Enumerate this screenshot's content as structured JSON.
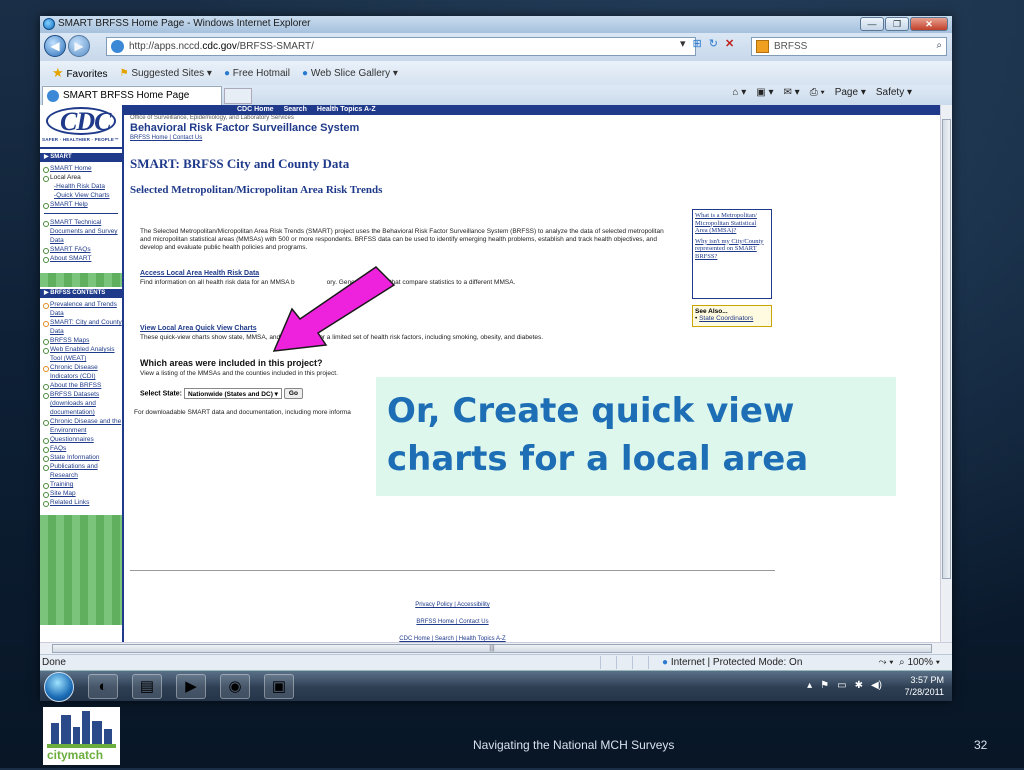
{
  "browser": {
    "title": "SMART BRFSS Home Page - Windows Internet Explorer",
    "url_prefix": "http://apps.nccd.",
    "url_domain": "cdc.gov",
    "url_path": "/BRFSS-SMART/",
    "search_placeholder": "BRFSS",
    "favorites_label": "Favorites",
    "fav_items": [
      "Suggested Sites ▾",
      "Free Hotmail",
      "Web Slice Gallery ▾"
    ],
    "tab_title": "SMART BRFSS Home Page",
    "command_items": [
      "Page ▾",
      "Safety ▾"
    ]
  },
  "status": {
    "left": "Done",
    "zone": "Internet | Protected Mode: On",
    "zoom": "100%"
  },
  "taskbar": {
    "time": "3:57 PM",
    "date": "7/28/2011"
  },
  "cdc": {
    "logo": "CDC",
    "logo_tag": "SAFER · HEALTHIER · PEOPLE™",
    "top_links": [
      "CDC Home",
      "Search",
      "Health Topics A-Z"
    ],
    "office": "Office of Surveillance, Epidemiology, and Laboratory Services",
    "system_name": "Behavioral Risk Factor Surveillance System",
    "header_links": "BRFSS Home | Contact Us",
    "sidebar_smart_head": "SMART",
    "sidebar_smart": [
      {
        "label": "SMART Home",
        "link": true
      },
      {
        "label": "Local Area",
        "link": false
      },
      {
        "label": "-Health Risk Data",
        "link": true,
        "sub": true
      },
      {
        "label": "-Quick View Charts",
        "link": true,
        "sub": true
      },
      {
        "label": "SMART Help",
        "link": true
      }
    ],
    "sidebar_smart2": [
      "SMART Technical Documents and Survey Data",
      "SMART FAQs",
      "About SMART"
    ],
    "sidebar_brfss_head": "BRFSS CONTENTS",
    "sidebar_brfss": [
      "Prevalence and Trends Data",
      "SMART: City and County Data",
      "BRFSS Maps",
      "Web Enabled Analysis Tool (WEAT)",
      "Chronic Disease Indicators (CDI)",
      "About the BRFSS",
      "BRFSS Datasets (downloads and documentation)",
      "Chronic Disease and the Environment",
      "Questionnaires",
      "FAQs",
      "State Information",
      "Publications and Research",
      "Training",
      "Site Map",
      "Related Links"
    ],
    "page_title": "SMART: BRFSS City and County Data",
    "page_subtitle": "Selected Metropolitan/Micropolitan Area Risk Trends",
    "intro": "The Selected Metropolitan/Micropolitan Area Risk Trends (SMART) project uses the Behavioral Risk Factor Surveillance System (BRFSS) to analyze the data of selected metropolitan and micropolitan statistical areas (MMSAs) with 500 or more respondents. BRFSS data can be used to identify emerging health problems, establish and track health objectives, and develop and evaluate public health policies and programs.",
    "link1": "Access Local Area Health Risk Data",
    "link1_desc_a": "Find information on all health risk data for an MMSA b",
    "link1_desc_b": "ory. Generate reports that compare statistics to a different MMSA.",
    "link2": "View Local Area Quick View Charts",
    "link2_desc": "These quick-view charts show state, MMSA, and county data for a limited set of health risk factors, including smoking, obesity, and diabetes.",
    "question": "Which areas were included in this project?",
    "question_desc": "View a listing of the MMSAs and the counties included in this project.",
    "select_label": "Select State:",
    "select_value": "Nationwide (States and DC)",
    "go_label": "Go",
    "download_text": "For downloadable SMART data and documentation, including more informa",
    "info_links": [
      "What is a Metropolitan/ Micropolitan Statistical Area (MMSA)?",
      "Why isn't my City/County represented on SMART BRFSS?"
    ],
    "see_also_head": "See Also...",
    "see_also_link": "State Coordinators",
    "footer1": "Privacy Policy | Accessibility",
    "footer2": "BRFSS Home | Contact Us",
    "footer3": "CDC Home | Search | Health Topics A-Z"
  },
  "callout": {
    "line1": "Or, Create quick view",
    "line2": "charts for a local area"
  },
  "slide": {
    "logo_text": "citymatch",
    "footer": "Navigating the National MCH Surveys",
    "page_number": "32"
  },
  "colors": {
    "arrow": "#ee22dd",
    "callout_text": "#1d6eb5",
    "callout_bg": "#ddf7ec",
    "cdc_blue": "#1f3a8a"
  }
}
